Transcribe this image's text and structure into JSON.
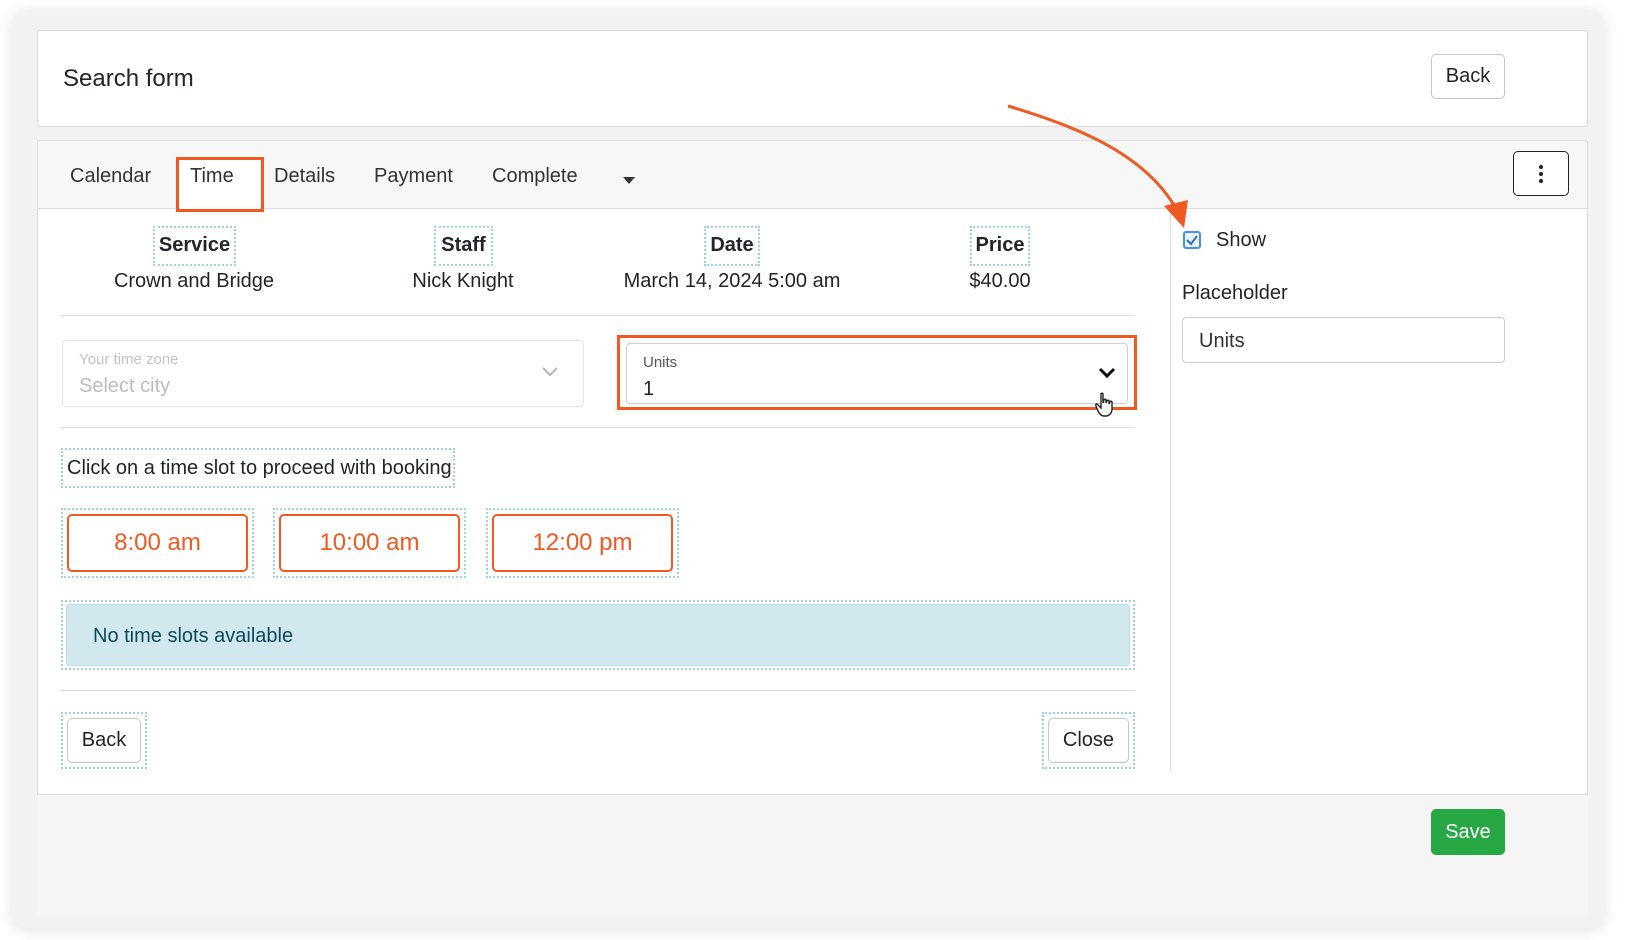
{
  "header": {
    "title": "Search form",
    "back_label": "Back"
  },
  "tabs": [
    "Calendar",
    "Time",
    "Details",
    "Payment",
    "Complete"
  ],
  "active_tab": "Time",
  "summary": {
    "service": {
      "label": "Service",
      "value": "Crown and Bridge"
    },
    "staff": {
      "label": "Staff",
      "value": "Nick Knight"
    },
    "date": {
      "label": "Date",
      "value": "March 14, 2024 5:00 am"
    },
    "price": {
      "label": "Price",
      "value": "$40.00"
    }
  },
  "timezone": {
    "label": "Your time zone",
    "placeholder": "Select city"
  },
  "units": {
    "label": "Units",
    "value": "1"
  },
  "instruction": "Click on a time slot to proceed with booking",
  "slots": [
    "8:00 am",
    "10:00 am",
    "12:00 pm"
  ],
  "alert": "No time slots available",
  "nav": {
    "back_label": "Back",
    "close_label": "Close"
  },
  "sidebar": {
    "show_label": "Show",
    "show_checked": true,
    "placeholder_label": "Placeholder",
    "placeholder_value": "Units"
  },
  "footer": {
    "save_label": "Save"
  },
  "colors": {
    "accent": "#f05a22",
    "save": "#28a745",
    "alert_bg": "#d1e8ee",
    "guide": "#9fd3e3"
  }
}
